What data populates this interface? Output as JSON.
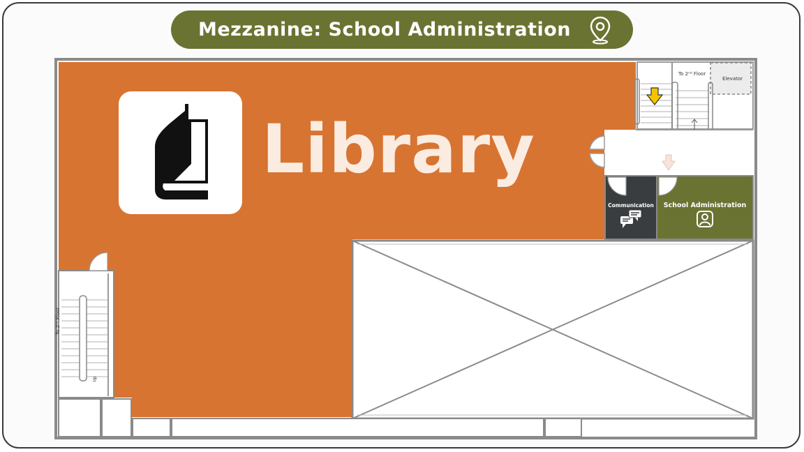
{
  "header": {
    "title": "Mezzanine: School Administration",
    "icon": "location-pin-icon"
  },
  "rooms": {
    "library": {
      "label": "Library",
      "icon": "book-icon",
      "color": "#d87431"
    },
    "communication": {
      "label": "Communication",
      "icon": "chat-bubbles-icon",
      "color": "#3a3d3f"
    },
    "school_admin": {
      "label": "School Administration",
      "icon": "person-badge-icon",
      "color": "#6b7332"
    },
    "elevator": {
      "label": "Elevator"
    }
  },
  "stairs": {
    "top_label": "To 2ⁿᵈ Floor",
    "left_label": "To 2ⁿᵈ Floor",
    "up_label": "Up"
  },
  "markers": {
    "current_location_arrow": "yellow-down-arrow-icon"
  },
  "colors": {
    "wall": "#8a8a8a",
    "title_bg": "#6b7332",
    "arrow": "#f5c400"
  }
}
